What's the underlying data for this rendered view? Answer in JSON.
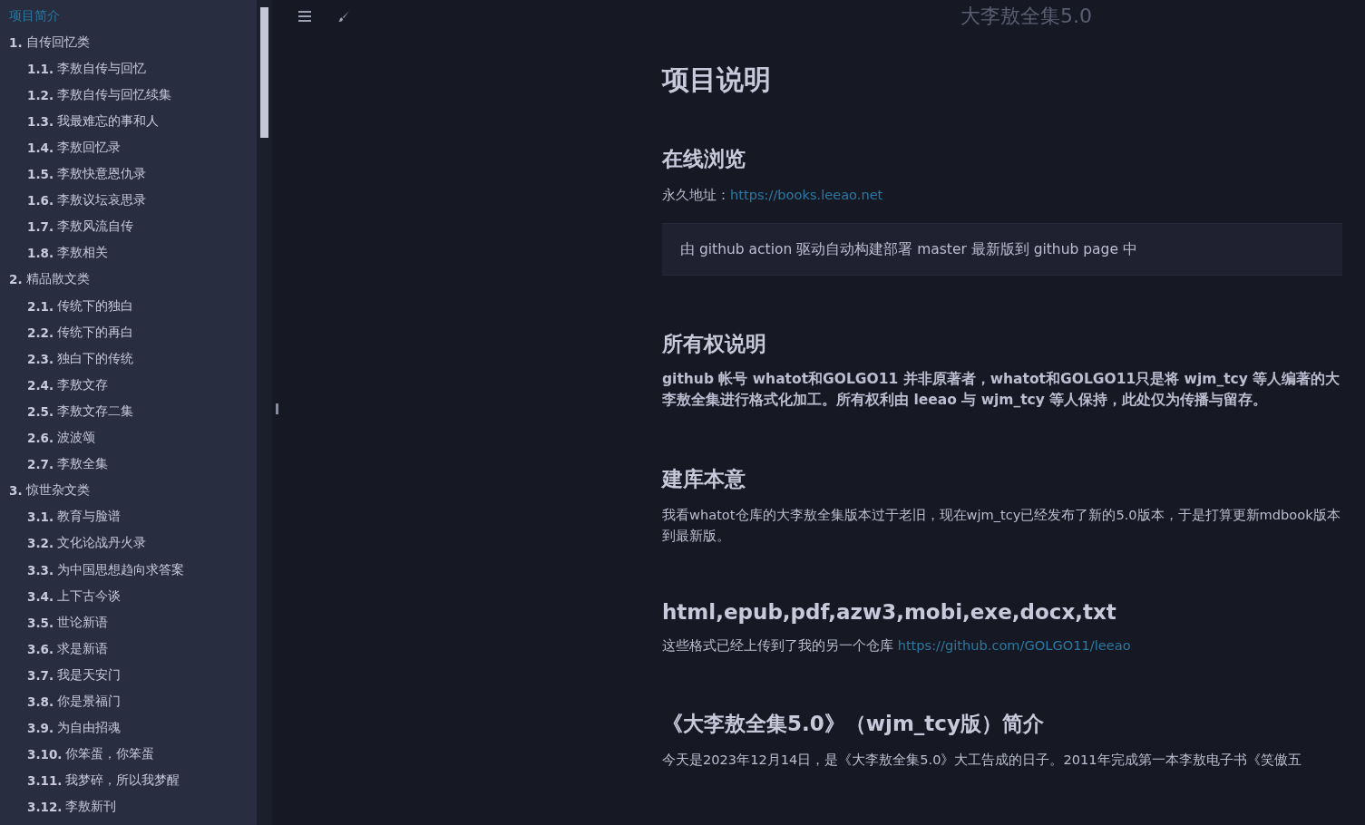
{
  "sidebar": {
    "items": [
      {
        "label": "项目简介",
        "selected": true
      },
      {
        "number": "1.",
        "label": "自传回忆类",
        "selected": false,
        "children": [
          {
            "number": "1.1.",
            "label": "李敖自传与回忆",
            "selected": false
          },
          {
            "number": "1.2.",
            "label": "李敖自传与回忆续集",
            "selected": false
          },
          {
            "number": "1.3.",
            "label": "我最难忘的事和人",
            "selected": false
          },
          {
            "number": "1.4.",
            "label": "李敖回忆录",
            "selected": false
          },
          {
            "number": "1.5.",
            "label": "李敖快意恩仇录",
            "selected": false
          },
          {
            "number": "1.6.",
            "label": "李敖议坛哀思录",
            "selected": false
          },
          {
            "number": "1.7.",
            "label": "李敖风流自传",
            "selected": false
          },
          {
            "number": "1.8.",
            "label": "李敖相关",
            "selected": false
          }
        ]
      },
      {
        "number": "2.",
        "label": "精品散文类",
        "selected": false,
        "children": [
          {
            "number": "2.1.",
            "label": "传统下的独白",
            "selected": false
          },
          {
            "number": "2.2.",
            "label": "传统下的再白",
            "selected": false
          },
          {
            "number": "2.3.",
            "label": "独白下的传统",
            "selected": false
          },
          {
            "number": "2.4.",
            "label": "李敖文存",
            "selected": false
          },
          {
            "number": "2.5.",
            "label": "李敖文存二集",
            "selected": false
          },
          {
            "number": "2.6.",
            "label": "波波颂",
            "selected": false
          },
          {
            "number": "2.7.",
            "label": "李敖全集",
            "selected": false
          }
        ]
      },
      {
        "number": "3.",
        "label": "惊世杂文类",
        "selected": false,
        "children": [
          {
            "number": "3.1.",
            "label": "教育与脸谱",
            "selected": false
          },
          {
            "number": "3.2.",
            "label": "文化论战丹火录",
            "selected": false
          },
          {
            "number": "3.3.",
            "label": "为中国思想趋向求答案",
            "selected": false
          },
          {
            "number": "3.4.",
            "label": "上下古今谈",
            "selected": false
          },
          {
            "number": "3.5.",
            "label": "世论新语",
            "selected": false
          },
          {
            "number": "3.6.",
            "label": "求是新语",
            "selected": false
          },
          {
            "number": "3.7.",
            "label": "我是天安门",
            "selected": false
          },
          {
            "number": "3.8.",
            "label": "你是景福门",
            "selected": false
          },
          {
            "number": "3.9.",
            "label": "为自由招魂",
            "selected": false
          },
          {
            "number": "3.10.",
            "label": "你笨蛋，你笨蛋",
            "selected": false
          },
          {
            "number": "3.11.",
            "label": "我梦碎，所以我梦醒",
            "selected": false
          },
          {
            "number": "3.12.",
            "label": "李敖新刊",
            "selected": false
          }
        ]
      }
    ]
  },
  "menu_bar": {
    "title": "大李敖全集5.0"
  },
  "content": {
    "blocks": [
      {
        "kind": "h1",
        "text": "项目说明"
      },
      {
        "kind": "h2",
        "text": "在线浏览"
      },
      {
        "kind": "p",
        "parts": [
          {
            "kind": "text",
            "text": "永久地址："
          },
          {
            "kind": "link",
            "text": "https://books.leeao.net"
          }
        ]
      },
      {
        "kind": "quote",
        "text": "由 github action 驱动自动构建部署 master 最新版到 github page 中"
      },
      {
        "kind": "h2",
        "text": "所有权说明"
      },
      {
        "kind": "strong",
        "text": "github 帐号 whatot和GOLGO11 并非原著者，whatot和GOLGO11只是将 wjm_tcy 等人编著的大李敖全集进行格式化加工。所有权利由 leeao 与 wjm_tcy 等人保持，此处仅为传播与留存。"
      },
      {
        "kind": "h2",
        "text": "建库本意"
      },
      {
        "kind": "p",
        "parts": [
          {
            "kind": "text",
            "text": "我看whatot仓库的大李敖全集版本过于老旧，现在wjm_tcy已经发布了新的5.0版本，于是打算更新mdbook版本到最新版。"
          }
        ]
      },
      {
        "kind": "h2",
        "text": "html,epub,pdf,azw3,mobi,exe,docx,txt"
      },
      {
        "kind": "p",
        "parts": [
          {
            "kind": "text",
            "text": "这些格式已经上传到了我的另一个仓库 "
          },
          {
            "kind": "link",
            "text": "https://github.com/GOLGO11/leeao"
          }
        ]
      },
      {
        "kind": "h2",
        "text": "《大李敖全集5.0》（wjm_tcy版）简介"
      },
      {
        "kind": "p",
        "parts": [
          {
            "kind": "text",
            "text": "今天是2023年12月14日，是《大李敖全集5.0》大工告成的日子。2011年完成第一本李敖电子书《笑傲五"
          }
        ]
      }
    ]
  }
}
